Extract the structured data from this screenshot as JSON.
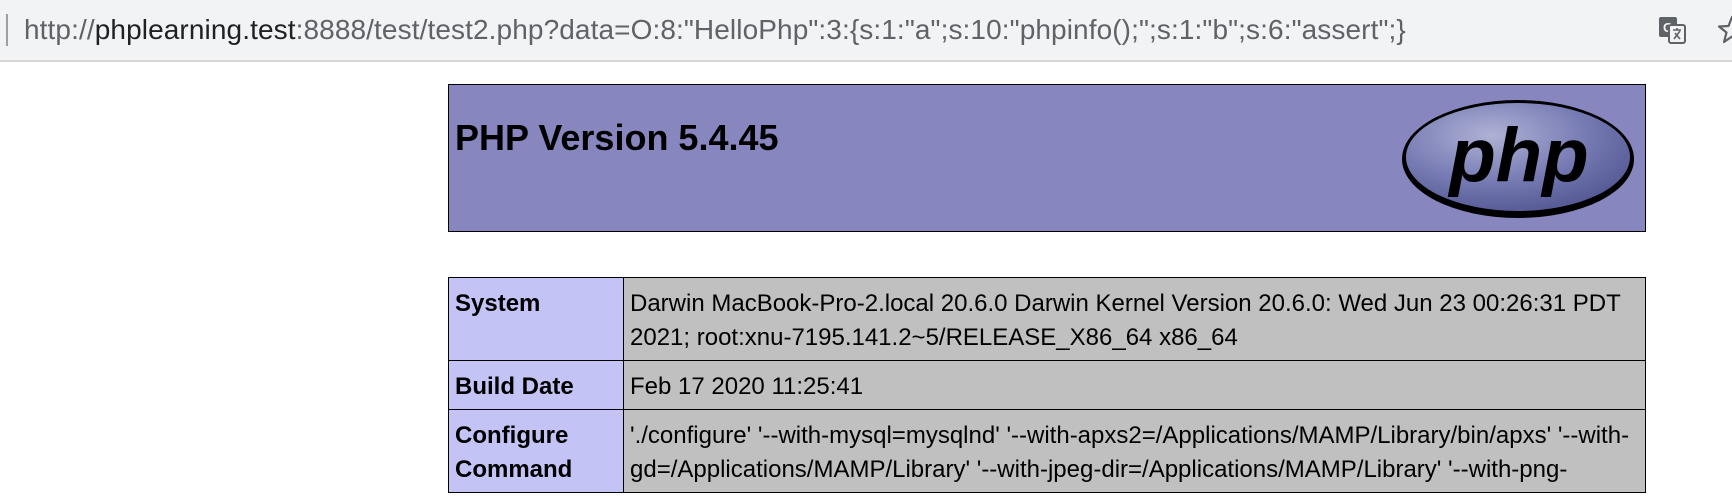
{
  "browser": {
    "url_host": "phplearning.test",
    "url_prefix": "http://",
    "url_rest": ":8888/test/test2.php?data=O:8:\"HelloPhp\":3:{s:1:\"a\";s:10:\"phpinfo();\";s:1:\"b\";s:6:\"assert\";}",
    "icons": [
      "translate-icon",
      "bookmark-star-icon"
    ]
  },
  "php": {
    "title": "PHP Version 5.4.45",
    "logo_text": "php",
    "rows": [
      {
        "key": "System",
        "value": "Darwin MacBook-Pro-2.local 20.6.0 Darwin Kernel Version 20.6.0: Wed Jun 23 00:26:31 PDT 2021; root:xnu-7195.141.2~5/RELEASE_X86_64 x86_64"
      },
      {
        "key": "Build Date",
        "value": "Feb 17 2020 11:25:41"
      },
      {
        "key": "Configure Command",
        "value": "'./configure' '--with-mysql=mysqlnd' '--with-apxs2=/Applications/MAMP/Library/bin/apxs' '--with-gd=/Applications/MAMP/Library' '--with-jpeg-dir=/Applications/MAMP/Library' '--with-png-"
      }
    ]
  },
  "colors": {
    "header_bg": "#8886bf",
    "key_cell_bg": "#c3c3f6",
    "value_cell_bg": "#c0c0c0",
    "chrome_bar": "#f1f3f4"
  }
}
